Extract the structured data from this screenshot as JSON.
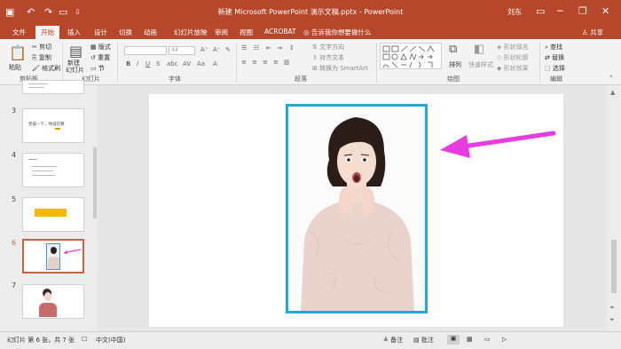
{
  "window": {
    "title": "新建 Microsoft PowerPoint 演示文稿.pptx - PowerPoint",
    "user": "刘东"
  },
  "tabs": [
    {
      "label": "文件"
    },
    {
      "label": "开始"
    },
    {
      "label": "插入"
    },
    {
      "label": "设计"
    },
    {
      "label": "切换"
    },
    {
      "label": "动画"
    },
    {
      "label": "幻灯片放映"
    },
    {
      "label": "审阅"
    },
    {
      "label": "视图"
    },
    {
      "label": "ACROBAT"
    }
  ],
  "tell_me": "告诉我你想要做什么",
  "share": "共享",
  "ribbon": {
    "clipboard": {
      "paste": "粘贴",
      "cut": "剪切",
      "copy": "复制",
      "format_painter": "格式刷",
      "label": "剪贴板"
    },
    "slides": {
      "new_slide": "新建",
      "new_slide2": "幻灯片",
      "layout": "版式",
      "reset": "重置",
      "section": "节",
      "label": "幻灯片"
    },
    "font": {
      "size": "44",
      "label": "字体"
    },
    "paragraph": {
      "text_direction": "文字方向",
      "align_text": "对齐文本",
      "smartart": "转换为 SmartArt",
      "label": "段落"
    },
    "drawing": {
      "arrange": "排列",
      "quick_styles": "快速样式",
      "shape_fill": "形状填充",
      "shape_outline": "形状轮廓",
      "shape_effects": "形状效果",
      "label": "绘图"
    },
    "editing": {
      "find": "查找",
      "replace": "替换",
      "select": "选择",
      "label": "编辑"
    }
  },
  "thumbnails": [
    {
      "num": "3",
      "text": "完成一下，你说在哪"
    },
    {
      "num": "4",
      "text": ""
    },
    {
      "num": "5",
      "text": ""
    },
    {
      "num": "6",
      "text": ""
    },
    {
      "num": "7",
      "text": ""
    }
  ],
  "status": {
    "slide_info": "幻灯片 第 6 张，共 7 张",
    "language": "中文(中国)",
    "notes": "备注",
    "comments": "批注"
  },
  "colors": {
    "accent": "#b7472a",
    "image_border": "#22a7d8",
    "arrow": "#e63ce0",
    "selected_thumb": "#c8643c"
  }
}
